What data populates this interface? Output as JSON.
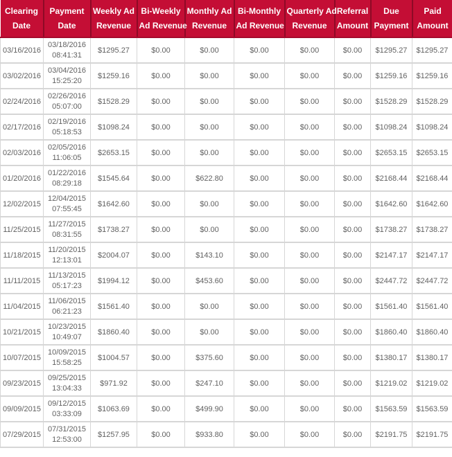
{
  "colors": {
    "header_bg": "#C40E35",
    "header_separator": "#8E0A26",
    "header_bottom_border": "#A50B2D",
    "header_text": "#FFFFFF",
    "body_border": "#D6D6D6",
    "body_text": "#616161",
    "row_bg": "#FFFFFF"
  },
  "table": {
    "headers": [
      {
        "id": "clearing-date",
        "line1": "Clearing",
        "line2": "Date"
      },
      {
        "id": "payment-date",
        "line1": "Payment",
        "line2": "Date"
      },
      {
        "id": "weekly-ad-revenue",
        "line1": "Weekly Ad",
        "line2": "Revenue"
      },
      {
        "id": "bi-weekly-ad-revenue",
        "line1": "Bi-Weekly",
        "line2": "Ad Revenue"
      },
      {
        "id": "monthly-ad-revenue",
        "line1": "Monthly Ad",
        "line2": "Revenue"
      },
      {
        "id": "bi-monthly-ad-revenue",
        "line1": "Bi-Monthly",
        "line2": "Ad Revenue"
      },
      {
        "id": "quarterly-ad-revenue",
        "line1": "Quarterly Ad",
        "line2": "Revenue"
      },
      {
        "id": "referral-amount",
        "line1": "Referral",
        "line2": "Amount"
      },
      {
        "id": "due-payment",
        "line1": "Due",
        "line2": "Payment"
      },
      {
        "id": "paid-amount",
        "line1": "Paid",
        "line2": "Amount"
      }
    ],
    "rows": [
      {
        "clearing_date": "03/16/2016",
        "payment_date": "03/18/2016",
        "payment_time": "08:41:31",
        "weekly_ad_revenue": "$1295.27",
        "bi_weekly_ad_revenue": "$0.00",
        "monthly_ad_revenue": "$0.00",
        "bi_monthly_ad_revenue": "$0.00",
        "quarterly_ad_revenue": "$0.00",
        "referral_amount": "$0.00",
        "due_payment": "$1295.27",
        "paid_amount": "$1295.27"
      },
      {
        "clearing_date": "03/02/2016",
        "payment_date": "03/04/2016",
        "payment_time": "15:25:20",
        "weekly_ad_revenue": "$1259.16",
        "bi_weekly_ad_revenue": "$0.00",
        "monthly_ad_revenue": "$0.00",
        "bi_monthly_ad_revenue": "$0.00",
        "quarterly_ad_revenue": "$0.00",
        "referral_amount": "$0.00",
        "due_payment": "$1259.16",
        "paid_amount": "$1259.16"
      },
      {
        "clearing_date": "02/24/2016",
        "payment_date": "02/26/2016",
        "payment_time": "05:07:00",
        "weekly_ad_revenue": "$1528.29",
        "bi_weekly_ad_revenue": "$0.00",
        "monthly_ad_revenue": "$0.00",
        "bi_monthly_ad_revenue": "$0.00",
        "quarterly_ad_revenue": "$0.00",
        "referral_amount": "$0.00",
        "due_payment": "$1528.29",
        "paid_amount": "$1528.29"
      },
      {
        "clearing_date": "02/17/2016",
        "payment_date": "02/19/2016",
        "payment_time": "05:18:53",
        "weekly_ad_revenue": "$1098.24",
        "bi_weekly_ad_revenue": "$0.00",
        "monthly_ad_revenue": "$0.00",
        "bi_monthly_ad_revenue": "$0.00",
        "quarterly_ad_revenue": "$0.00",
        "referral_amount": "$0.00",
        "due_payment": "$1098.24",
        "paid_amount": "$1098.24"
      },
      {
        "clearing_date": "02/03/2016",
        "payment_date": "02/05/2016",
        "payment_time": "11:06:05",
        "weekly_ad_revenue": "$2653.15",
        "bi_weekly_ad_revenue": "$0.00",
        "monthly_ad_revenue": "$0.00",
        "bi_monthly_ad_revenue": "$0.00",
        "quarterly_ad_revenue": "$0.00",
        "referral_amount": "$0.00",
        "due_payment": "$2653.15",
        "paid_amount": "$2653.15"
      },
      {
        "clearing_date": "01/20/2016",
        "payment_date": "01/22/2016",
        "payment_time": "08:29:18",
        "weekly_ad_revenue": "$1545.64",
        "bi_weekly_ad_revenue": "$0.00",
        "monthly_ad_revenue": "$622.80",
        "bi_monthly_ad_revenue": "$0.00",
        "quarterly_ad_revenue": "$0.00",
        "referral_amount": "$0.00",
        "due_payment": "$2168.44",
        "paid_amount": "$2168.44"
      },
      {
        "clearing_date": "12/02/2015",
        "payment_date": "12/04/2015",
        "payment_time": "07:55:45",
        "weekly_ad_revenue": "$1642.60",
        "bi_weekly_ad_revenue": "$0.00",
        "monthly_ad_revenue": "$0.00",
        "bi_monthly_ad_revenue": "$0.00",
        "quarterly_ad_revenue": "$0.00",
        "referral_amount": "$0.00",
        "due_payment": "$1642.60",
        "paid_amount": "$1642.60"
      },
      {
        "clearing_date": "11/25/2015",
        "payment_date": "11/27/2015",
        "payment_time": "08:31:55",
        "weekly_ad_revenue": "$1738.27",
        "bi_weekly_ad_revenue": "$0.00",
        "monthly_ad_revenue": "$0.00",
        "bi_monthly_ad_revenue": "$0.00",
        "quarterly_ad_revenue": "$0.00",
        "referral_amount": "$0.00",
        "due_payment": "$1738.27",
        "paid_amount": "$1738.27"
      },
      {
        "clearing_date": "11/18/2015",
        "payment_date": "11/20/2015",
        "payment_time": "12:13:01",
        "weekly_ad_revenue": "$2004.07",
        "bi_weekly_ad_revenue": "$0.00",
        "monthly_ad_revenue": "$143.10",
        "bi_monthly_ad_revenue": "$0.00",
        "quarterly_ad_revenue": "$0.00",
        "referral_amount": "$0.00",
        "due_payment": "$2147.17",
        "paid_amount": "$2147.17"
      },
      {
        "clearing_date": "11/11/2015",
        "payment_date": "11/13/2015",
        "payment_time": "05:17:23",
        "weekly_ad_revenue": "$1994.12",
        "bi_weekly_ad_revenue": "$0.00",
        "monthly_ad_revenue": "$453.60",
        "bi_monthly_ad_revenue": "$0.00",
        "quarterly_ad_revenue": "$0.00",
        "referral_amount": "$0.00",
        "due_payment": "$2447.72",
        "paid_amount": "$2447.72"
      },
      {
        "clearing_date": "11/04/2015",
        "payment_date": "11/06/2015",
        "payment_time": "06:21:23",
        "weekly_ad_revenue": "$1561.40",
        "bi_weekly_ad_revenue": "$0.00",
        "monthly_ad_revenue": "$0.00",
        "bi_monthly_ad_revenue": "$0.00",
        "quarterly_ad_revenue": "$0.00",
        "referral_amount": "$0.00",
        "due_payment": "$1561.40",
        "paid_amount": "$1561.40"
      },
      {
        "clearing_date": "10/21/2015",
        "payment_date": "10/23/2015",
        "payment_time": "10:49:07",
        "weekly_ad_revenue": "$1860.40",
        "bi_weekly_ad_revenue": "$0.00",
        "monthly_ad_revenue": "$0.00",
        "bi_monthly_ad_revenue": "$0.00",
        "quarterly_ad_revenue": "$0.00",
        "referral_amount": "$0.00",
        "due_payment": "$1860.40",
        "paid_amount": "$1860.40"
      },
      {
        "clearing_date": "10/07/2015",
        "payment_date": "10/09/2015",
        "payment_time": "15:58:25",
        "weekly_ad_revenue": "$1004.57",
        "bi_weekly_ad_revenue": "$0.00",
        "monthly_ad_revenue": "$375.60",
        "bi_monthly_ad_revenue": "$0.00",
        "quarterly_ad_revenue": "$0.00",
        "referral_amount": "$0.00",
        "due_payment": "$1380.17",
        "paid_amount": "$1380.17"
      },
      {
        "clearing_date": "09/23/2015",
        "payment_date": "09/25/2015",
        "payment_time": "13:04:33",
        "weekly_ad_revenue": "$971.92",
        "bi_weekly_ad_revenue": "$0.00",
        "monthly_ad_revenue": "$247.10",
        "bi_monthly_ad_revenue": "$0.00",
        "quarterly_ad_revenue": "$0.00",
        "referral_amount": "$0.00",
        "due_payment": "$1219.02",
        "paid_amount": "$1219.02"
      },
      {
        "clearing_date": "09/09/2015",
        "payment_date": "09/12/2015",
        "payment_time": "03:33:09",
        "weekly_ad_revenue": "$1063.69",
        "bi_weekly_ad_revenue": "$0.00",
        "monthly_ad_revenue": "$499.90",
        "bi_monthly_ad_revenue": "$0.00",
        "quarterly_ad_revenue": "$0.00",
        "referral_amount": "$0.00",
        "due_payment": "$1563.59",
        "paid_amount": "$1563.59"
      },
      {
        "clearing_date": "07/29/2015",
        "payment_date": "07/31/2015",
        "payment_time": "12:53:00",
        "weekly_ad_revenue": "$1257.95",
        "bi_weekly_ad_revenue": "$0.00",
        "monthly_ad_revenue": "$933.80",
        "bi_monthly_ad_revenue": "$0.00",
        "quarterly_ad_revenue": "$0.00",
        "referral_amount": "$0.00",
        "due_payment": "$2191.75",
        "paid_amount": "$2191.75"
      }
    ]
  }
}
